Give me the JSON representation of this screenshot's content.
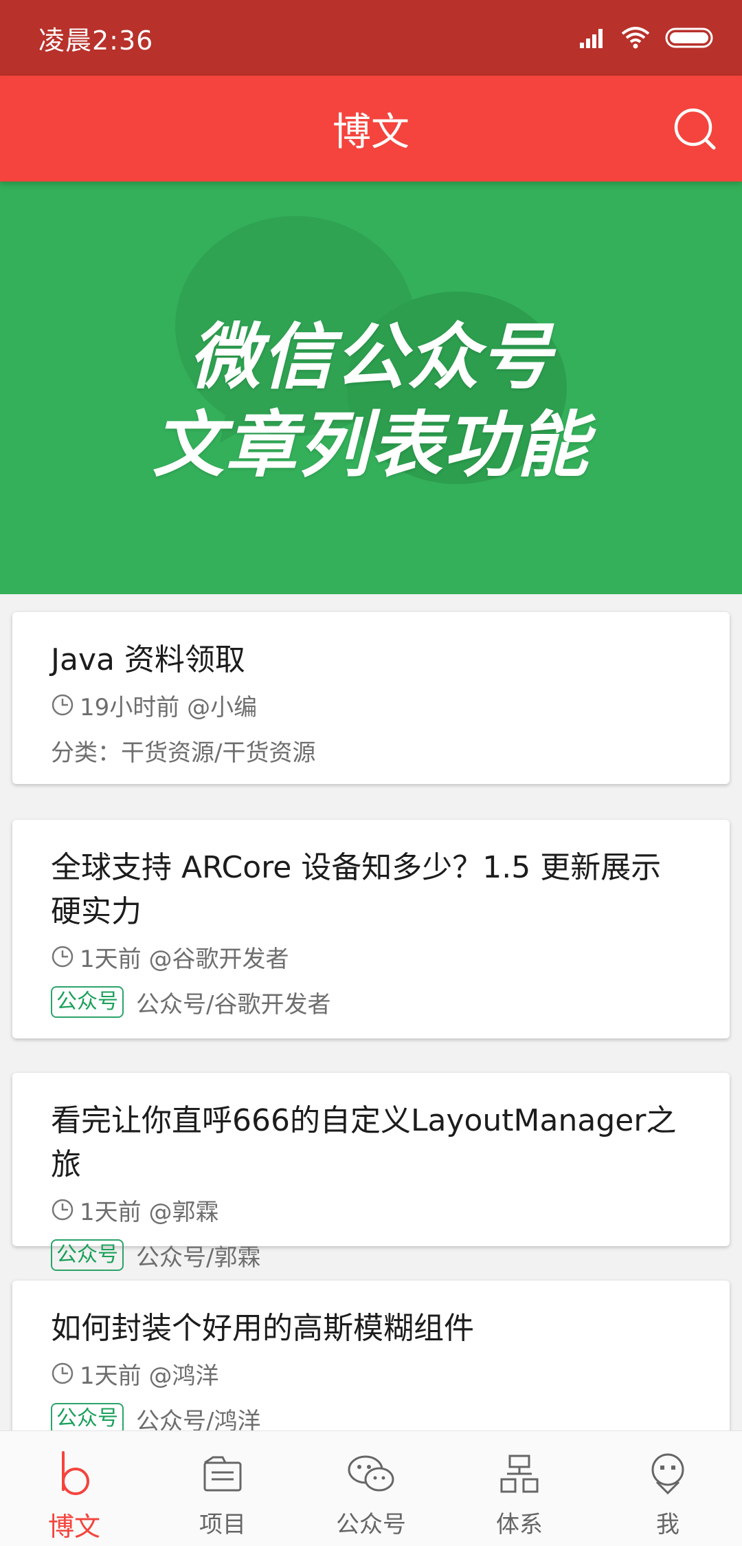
{
  "status_bar": {
    "time": "凌晨2:36",
    "icons": [
      "signal-icon",
      "wifi-icon",
      "battery-icon"
    ]
  },
  "app_bar": {
    "title": "博文",
    "search_icon": "search-icon"
  },
  "banner": {
    "line1": "微信公众号",
    "line2": "文章列表功能",
    "background": "#34b05a"
  },
  "articles": [
    {
      "title": "Java 资料领取",
      "time": "19小时前",
      "author": "@小编",
      "tag": "",
      "category_prefix": "分类：",
      "category": "干货资源/干货资源"
    },
    {
      "title": "全球支持 ARCore 设备知多少？1.5 更新展示硬实力",
      "time": "1天前",
      "author": "@谷歌开发者",
      "tag": "公众号",
      "category_prefix": "",
      "category": "公众号/谷歌开发者"
    },
    {
      "title": "看完让你直呼666的自定义LayoutManager之旅",
      "time": "1天前",
      "author": "@郭霖",
      "tag": "公众号",
      "category_prefix": "",
      "category": "公众号/郭霖"
    },
    {
      "title": "如何封装个好用的高斯模糊组件",
      "time": "1天前",
      "author": "@鸿洋",
      "tag": "公众号",
      "category_prefix": "",
      "category": "公众号/鸿洋"
    }
  ],
  "bottom_nav": [
    {
      "label": "博文",
      "icon": "blog-icon",
      "active": true
    },
    {
      "label": "项目",
      "icon": "project-icon",
      "active": false
    },
    {
      "label": "公众号",
      "icon": "wechat-icon",
      "active": false
    },
    {
      "label": "体系",
      "icon": "hierarchy-icon",
      "active": false
    },
    {
      "label": "我",
      "icon": "profile-icon",
      "active": false
    }
  ],
  "colors": {
    "status_bar": "#b8312b",
    "app_bar": "#f4443d",
    "accent": "#f4443d",
    "tag": "#19a05a"
  }
}
